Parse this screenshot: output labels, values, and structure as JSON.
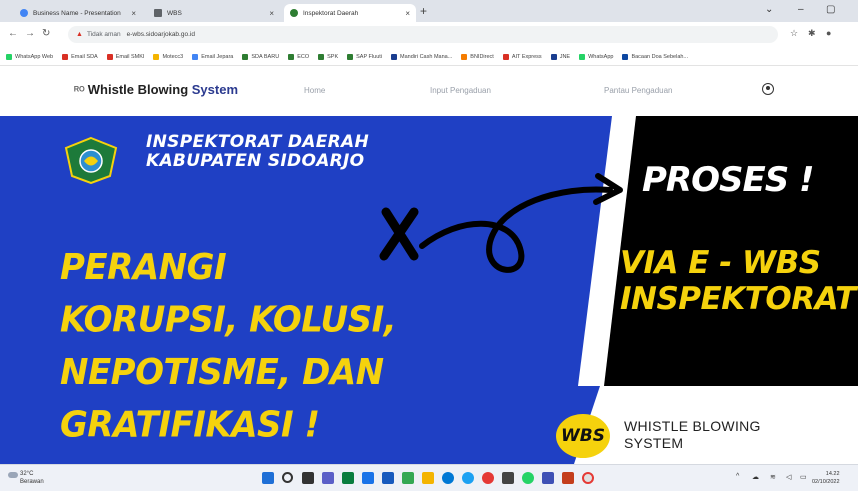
{
  "browser": {
    "tabs": [
      {
        "label": "Business Name - Presentation",
        "favicon_color": "#4285f4"
      },
      {
        "label": "WBS",
        "favicon_color": "#5f6368"
      },
      {
        "label": "Inspektorat Daerah",
        "favicon_color": "#2e7d32"
      }
    ],
    "new_tab": "+",
    "window_controls": [
      "⌄",
      "–",
      "▢"
    ],
    "address": {
      "security": "Tidak aman",
      "url": "e-wbs.sidoarjokab.go.id"
    },
    "bookmarks": [
      {
        "label": "WhatsApp Web",
        "color": "#25d366"
      },
      {
        "label": "Email SDA",
        "color": "#d93025"
      },
      {
        "label": "Email SMKI",
        "color": "#d93025"
      },
      {
        "label": "Motecc3",
        "color": "#f4b400"
      },
      {
        "label": "Email Jepara",
        "color": "#4285f4"
      },
      {
        "label": "SDA BARU",
        "color": "#2e7d32"
      },
      {
        "label": "ECO",
        "color": "#2e7d32"
      },
      {
        "label": "SPK",
        "color": "#2e7d32"
      },
      {
        "label": "SAP Fluuti",
        "color": "#2e7d32"
      },
      {
        "label": "Mandiri Cash Mana...",
        "color": "#1a3d8f"
      },
      {
        "label": "BNIDirect",
        "color": "#f57c00"
      },
      {
        "label": "AIT Express",
        "color": "#d93025"
      },
      {
        "label": "JNE",
        "color": "#1a3d8f"
      },
      {
        "label": "WhatsApp",
        "color": "#25d366"
      },
      {
        "label": "Bacaan Doa Sebelah...",
        "color": "#0d47a1"
      }
    ]
  },
  "site": {
    "brand_prefix": "Whistle Blowing ",
    "brand_suffix": "System",
    "nav": [
      "Home",
      "Input Pengaduan",
      "Pantau Pengaduan"
    ]
  },
  "hero": {
    "institution_line1": "INSPEKTORAT DAERAH",
    "institution_line2": "KABUPATEN SIDOARJO",
    "slogan": [
      "PERANGI",
      "KORUPSI, KOLUSI,",
      "NEPOTISME, DAN",
      "GRATIFIKASI !"
    ],
    "proses": "PROSES !",
    "via_line1": "VIA E - WBS",
    "via_line2": "INSPEKTORAT",
    "badge": "WBS",
    "badge_text_line1": "WHISTLE BLOWING",
    "badge_text_line2": "SYSTEM",
    "colors": {
      "blue": "#1f40c4",
      "black": "#000000",
      "yellow": "#f5d20d"
    }
  },
  "taskbar": {
    "weather_temp": "32°C",
    "weather_desc": "Berawan",
    "time": "14.22",
    "date": "02/10/2022"
  }
}
